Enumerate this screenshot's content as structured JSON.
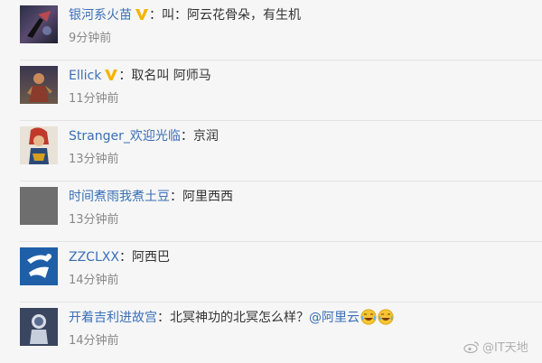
{
  "colors": {
    "username": "#3a6fb6",
    "text": "#333333",
    "time": "#888888",
    "verified_badge": "#f5b400",
    "background": "#f6f6f6"
  },
  "comments": [
    {
      "username": "银河系火苗",
      "verified": true,
      "separator": "：",
      "text": "叫：阿云花骨朵，有生机",
      "time": "9分钟前",
      "avatar": "avatar-dark-figure"
    },
    {
      "username": "Ellick",
      "verified": true,
      "separator": "：",
      "text": "取名叫 阿师马",
      "time": "11分钟前",
      "avatar": "avatar-warrior"
    },
    {
      "username": "Stranger_欢迎光临",
      "verified": false,
      "separator": "：",
      "text": "京润",
      "time": "13分钟前",
      "avatar": "avatar-red-hair-character"
    },
    {
      "username": "时间煮雨我煮土豆",
      "verified": false,
      "separator": "：",
      "text": "阿里西西",
      "time": "13分钟前",
      "avatar": "avatar-grey-placeholder"
    },
    {
      "username": "ZZCLXX",
      "verified": false,
      "separator": "：",
      "text": "阿西巴",
      "time": "14分钟前",
      "avatar": "avatar-blue-logo"
    },
    {
      "username": "开着吉利进故宫",
      "verified": false,
      "separator": "：",
      "text": "北冥神功的北冥怎么样？",
      "mention": "@阿里云",
      "emojis": [
        "laughing-emoji",
        "laughing-emoji"
      ],
      "time": "14分钟前",
      "avatar": "avatar-astronaut"
    }
  ],
  "watermark": {
    "icon": "weibo-icon",
    "text": "@IT天地"
  }
}
